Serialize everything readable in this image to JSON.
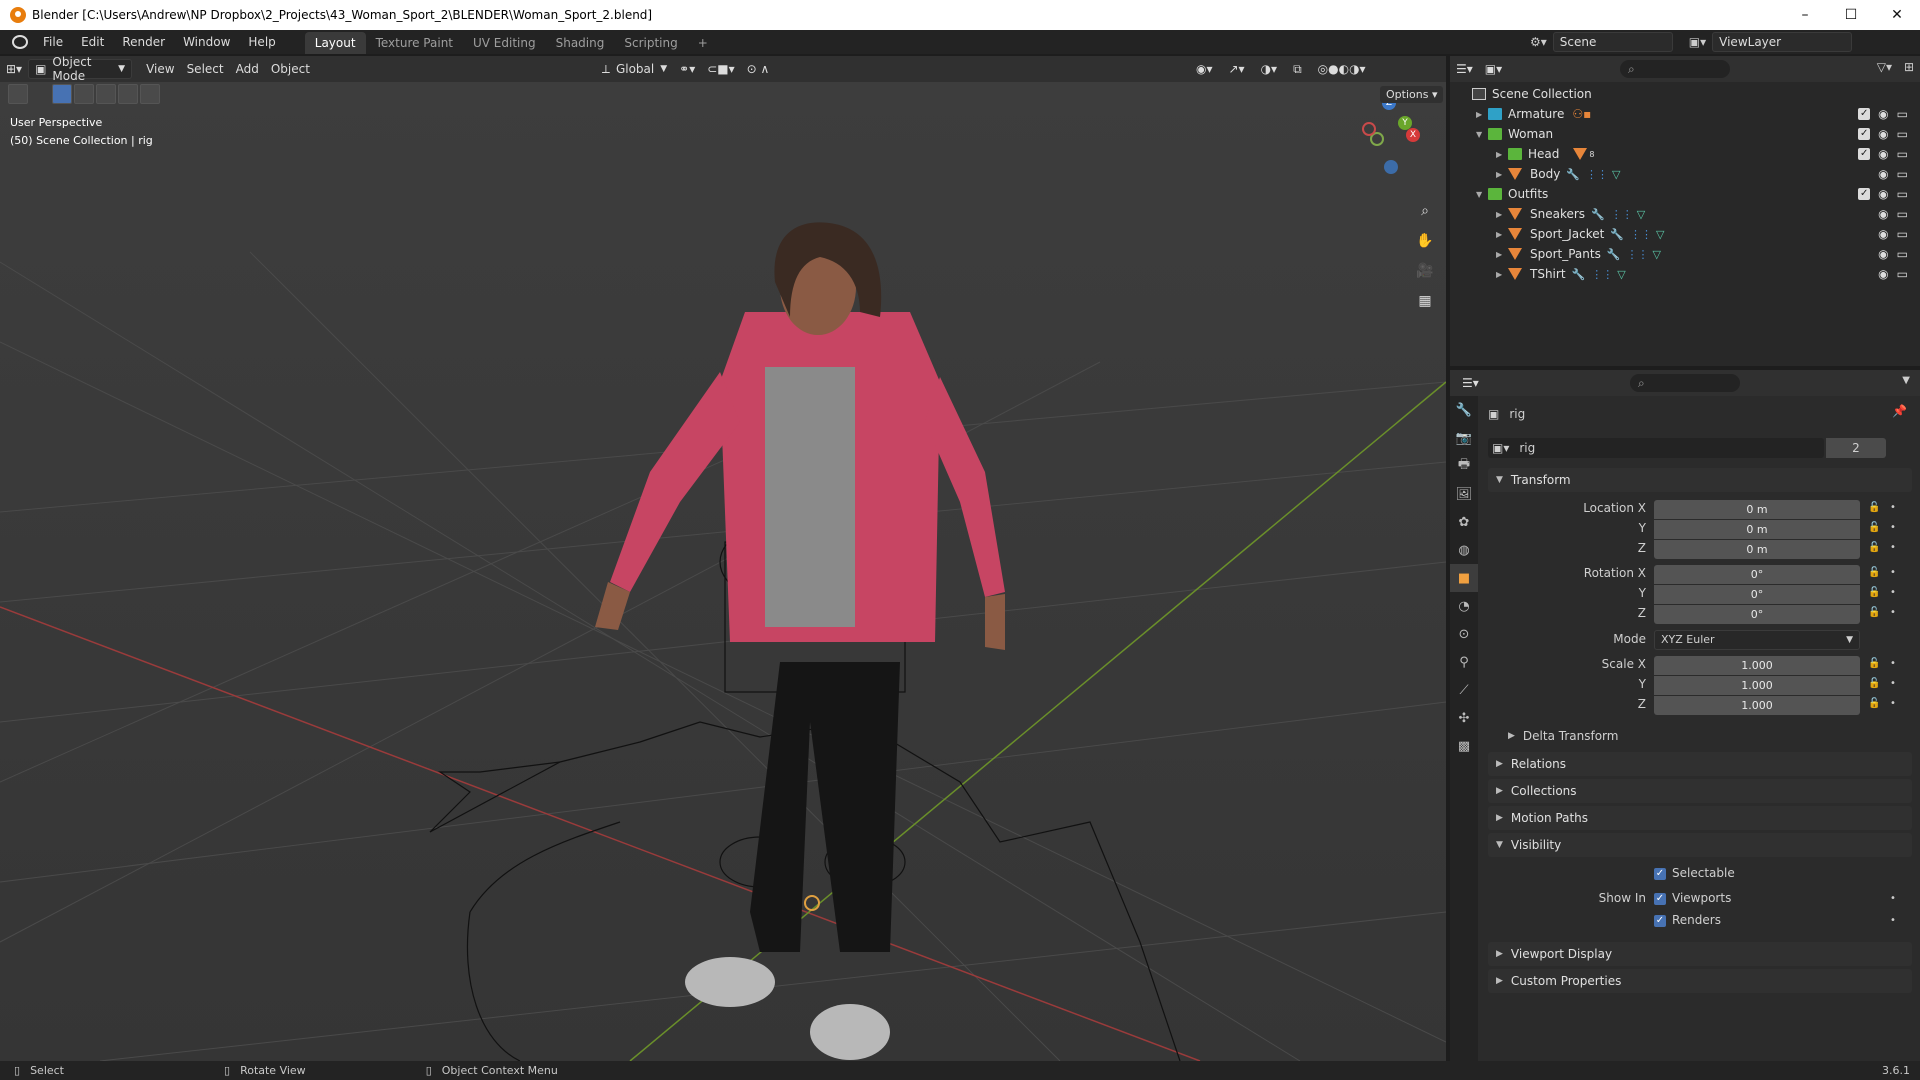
{
  "window": {
    "title": "Blender [C:\\Users\\Andrew\\NP Dropbox\\2_Projects\\43_Woman_Sport_2\\BLENDER\\Woman_Sport_2.blend]",
    "minimize": "–",
    "maximize": "☐",
    "close": "✕"
  },
  "menu": {
    "items": [
      "File",
      "Edit",
      "Render",
      "Window",
      "Help"
    ],
    "workspaces": [
      "Layout",
      "Texture Paint",
      "UV Editing",
      "Shading",
      "Scripting"
    ],
    "add_workspace": "+",
    "scene_label": "Scene",
    "viewlayer_label": "ViewLayer"
  },
  "viewport_header": {
    "mode": "Object Mode",
    "menus": [
      "View",
      "Select",
      "Add",
      "Object"
    ],
    "orientation": "Global"
  },
  "viewport": {
    "perspective": "User Perspective",
    "collection_info": "(50) Scene Collection | rig",
    "options": "Options",
    "nav_icons": [
      "zoom-icon",
      "hand-icon",
      "camera-icon",
      "grid-icon"
    ],
    "gizmo": {
      "x": "X",
      "y": "Y",
      "z": "Z"
    }
  },
  "outliner": {
    "root": "Scene Collection",
    "rows": [
      {
        "label": "Armature"
      },
      {
        "label": "Woman"
      },
      {
        "label": "Head",
        "badge": "8"
      },
      {
        "label": "Body"
      },
      {
        "label": "Outfits"
      },
      {
        "label": "Sneakers"
      },
      {
        "label": "Sport_Jacket"
      },
      {
        "label": "Sport_Pants"
      },
      {
        "label": "TShirt"
      }
    ]
  },
  "properties": {
    "object_name": "rig",
    "data_name": "rig",
    "users": "2",
    "transform": {
      "title": "Transform",
      "location_label": "Location X",
      "location": [
        "0 m",
        "0 m",
        "0 m"
      ],
      "rotation_label": "Rotation X",
      "rotation": [
        "0°",
        "0°",
        "0°"
      ],
      "mode_label": "Mode",
      "mode": "XYZ Euler",
      "scale_label": "Scale X",
      "scale": [
        "1.000",
        "1.000",
        "1.000"
      ],
      "y": "Y",
      "z": "Z"
    },
    "delta_transform": "Delta Transform",
    "relations": "Relations",
    "collections": "Collections",
    "motion_paths": "Motion Paths",
    "visibility": {
      "title": "Visibility",
      "selectable": "Selectable",
      "show_in": "Show In",
      "viewports": "Viewports",
      "renders": "Renders"
    },
    "viewport_display": "Viewport Display",
    "custom_properties": "Custom Properties"
  },
  "statusbar": {
    "select": "Select",
    "rotate": "Rotate View",
    "context": "Object Context Menu",
    "version": "3.6.1"
  }
}
